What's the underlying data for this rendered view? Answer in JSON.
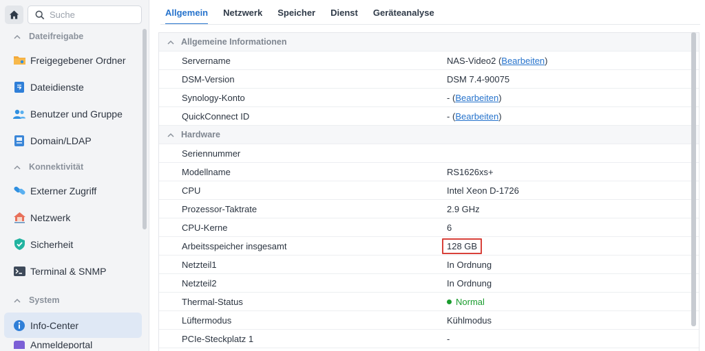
{
  "sidebar": {
    "search_placeholder": "Suche",
    "sections": [
      {
        "label": "Dateifreigabe",
        "items": [
          {
            "label": "Freigegebener Ordner",
            "icon": "shared-folder-icon"
          },
          {
            "label": "Dateidienste",
            "icon": "file-services-icon"
          },
          {
            "label": "Benutzer und Gruppe",
            "icon": "users-icon"
          },
          {
            "label": "Domain/LDAP",
            "icon": "domain-icon"
          }
        ]
      },
      {
        "label": "Konnektivität",
        "items": [
          {
            "label": "Externer Zugriff",
            "icon": "external-access-icon"
          },
          {
            "label": "Netzwerk",
            "icon": "network-icon"
          },
          {
            "label": "Sicherheit",
            "icon": "shield-icon"
          },
          {
            "label": "Terminal & SNMP",
            "icon": "terminal-icon"
          }
        ]
      },
      {
        "label": "System",
        "items": [
          {
            "label": "Info-Center",
            "icon": "info-icon",
            "active": true
          },
          {
            "label": "Anmeldeportal",
            "icon": "login-portal-icon"
          }
        ]
      }
    ]
  },
  "tabs": [
    "Allgemein",
    "Netzwerk",
    "Speicher",
    "Dienst",
    "Geräteanalyse"
  ],
  "active_tab": "Allgemein",
  "general": {
    "title": "Allgemeine Informationen",
    "servername_label": "Servername",
    "servername_value": "NAS-Video2",
    "dsm_label": "DSM-Version",
    "dsm_value": "DSM 7.4-90075",
    "synology_label": "Synology-Konto",
    "synology_value": "-",
    "quickconnect_label": "QuickConnect ID",
    "quickconnect_value": "-",
    "edit_label": "Bearbeiten",
    "paren_open": "(",
    "paren_close": ")"
  },
  "hardware": {
    "title": "Hardware",
    "serial_label": "Seriennummer",
    "serial_value": "",
    "model_label": "Modellname",
    "model_value": "RS1626xs+",
    "cpu_label": "CPU",
    "cpu_value": "Intel Xeon D-1726",
    "clock_label": "Prozessor-Taktrate",
    "clock_value": "2.9 GHz",
    "cores_label": "CPU-Kerne",
    "cores_value": "6",
    "ram_label": "Arbeitsspeicher insgesamt",
    "ram_value": "128 GB",
    "psu1_label": "Netzteil1",
    "psu1_value": "In Ordnung",
    "psu2_label": "Netzteil2",
    "psu2_value": "In Ordnung",
    "thermal_label": "Thermal-Status",
    "thermal_value": "Normal",
    "fan_label": "Lüftermodus",
    "fan_value": "Kühlmodus",
    "pcie_label": "PCIe-Steckplatz 1",
    "pcie_value": "-"
  },
  "colors": {
    "accent": "#2673cc",
    "status_ok": "#1a9c2e",
    "highlight_box": "#d8413a"
  }
}
